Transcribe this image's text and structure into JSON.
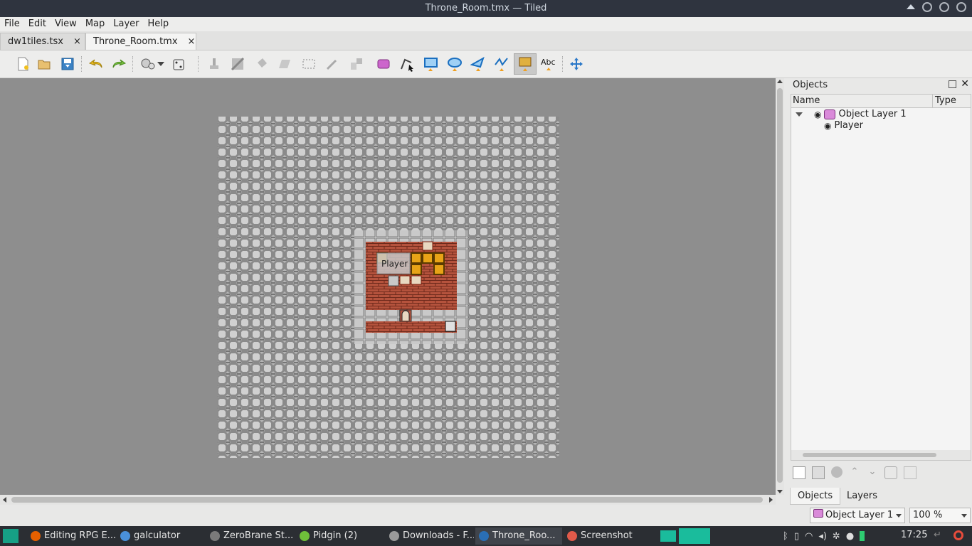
{
  "window": {
    "title": "Throne_Room.tmx — Tiled"
  },
  "menu": [
    "File",
    "Edit",
    "View",
    "Map",
    "Layer",
    "Help"
  ],
  "tabs": [
    {
      "label": "dw1tiles.tsx",
      "close": "×"
    },
    {
      "label": "Throne_Room.tmx",
      "close": "×"
    }
  ],
  "map": {
    "object_label": "Player",
    "colors": {
      "background": "#8e8e8e",
      "wall": "#9a9a9a",
      "floor": "#b7533c",
      "block": "#e8a317"
    }
  },
  "objects_panel": {
    "title": "Objects",
    "columns": {
      "name": "Name",
      "type": "Type"
    },
    "tree": [
      {
        "name": "Object Layer 1",
        "children": [
          {
            "name": "Player"
          }
        ]
      }
    ]
  },
  "panel_tabs": [
    "Objects",
    "Layers"
  ],
  "status": {
    "layer_select": "Object Layer 1",
    "zoom": "100 %"
  },
  "taskbar": {
    "items": [
      {
        "label": "Editing RPG E...",
        "color": "#e66000"
      },
      {
        "label": "galculator",
        "color": "#4a90d9"
      },
      {
        "label": "ZeroBrane St...",
        "color": "#7a7a7a"
      },
      {
        "label": "Pidgin (2)",
        "color": "#6fbf3a"
      },
      {
        "label": "Downloads - F...",
        "color": "#9a9a9a"
      },
      {
        "label": "Throne_Roo...",
        "color": "#2a6fb5"
      },
      {
        "label": "Screenshot",
        "color": "#e05a4a"
      }
    ],
    "clock": "17:25"
  }
}
